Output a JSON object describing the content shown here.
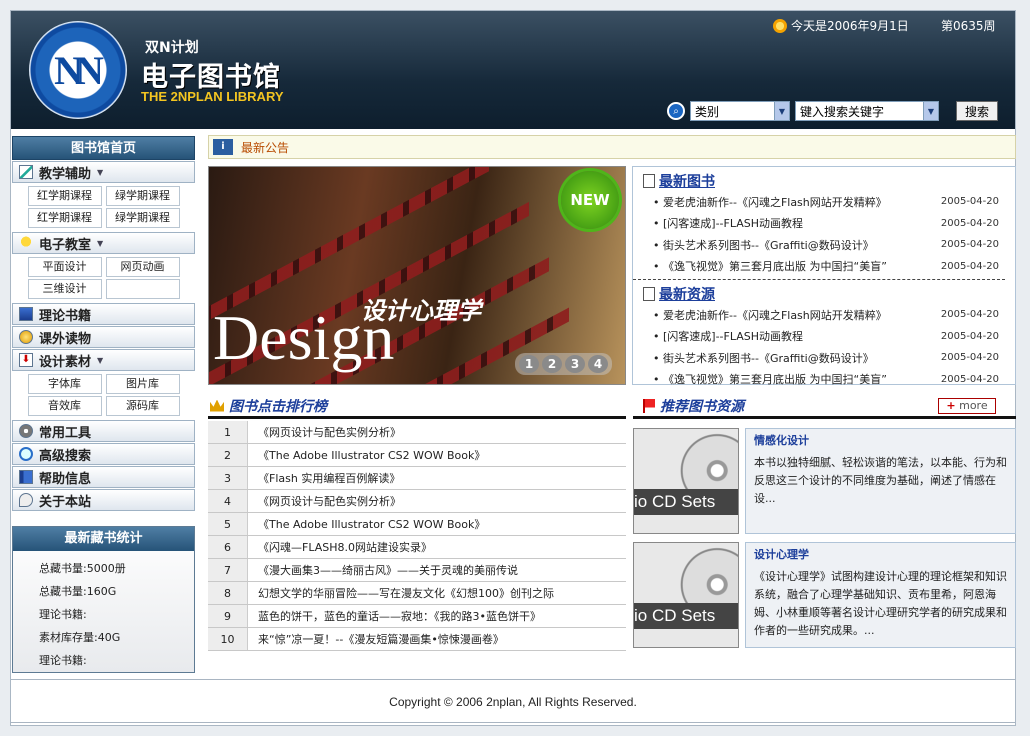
{
  "header": {
    "brand_sub": "双N计划",
    "brand_title": "电子图书馆",
    "brand_en": "THE 2NPLAN LIBRARY",
    "logo_mono": "NN",
    "date_text": "今天是2006年9月1日",
    "issue": "第0635周"
  },
  "search": {
    "category_value": "类别",
    "keyword_value": "键入搜索关键字",
    "button_label": "搜索"
  },
  "sidebar": {
    "title": "图书馆首页",
    "groups": [
      {
        "label": "教学辅助",
        "subs": [
          "红学期课程",
          "绿学期课程",
          "红学期课程",
          "绿学期课程"
        ]
      },
      {
        "label": "电子教室",
        "subs": [
          "平面设计",
          "网页动画",
          "三维设计",
          ""
        ]
      },
      {
        "label": "理论书籍"
      },
      {
        "label": "课外读物"
      },
      {
        "label": "设计素材",
        "subs": [
          "字体库",
          "图片库",
          "音效库",
          "源码库"
        ]
      },
      {
        "label": "常用工具"
      },
      {
        "label": "高级搜索"
      },
      {
        "label": "帮助信息"
      },
      {
        "label": "关于本站"
      }
    ]
  },
  "stats": {
    "title": "最新藏书统计",
    "items": [
      "总藏书量:5000册",
      "总藏书量:160G",
      "理论书籍:",
      "素材库存量:40G",
      "理论书籍:"
    ]
  },
  "notice": {
    "label": "最新公告"
  },
  "banner": {
    "cn": "设计心理学",
    "en": "Design",
    "badge": "NEW",
    "pages": [
      "1",
      "2",
      "3",
      "4"
    ]
  },
  "latest_books": {
    "title": "最新图书",
    "items": [
      {
        "t": "爱老虎油新作--《闪魂之Flash网站开发精粹》",
        "d": "2005-04-20"
      },
      {
        "t": "[闪客速成]--FLASH动画教程",
        "d": "2005-04-20"
      },
      {
        "t": "街头艺术系列图书--《Graffiti@数码设计》",
        "d": "2005-04-20"
      },
      {
        "t": "《逸飞视觉》第三套月底出版 为中国扫“美盲”",
        "d": "2005-04-20"
      }
    ]
  },
  "latest_resources": {
    "title": "最新资源",
    "items": [
      {
        "t": "爱老虎油新作--《闪魂之Flash网站开发精粹》",
        "d": "2005-04-20"
      },
      {
        "t": "[闪客速成]--FLASH动画教程",
        "d": "2005-04-20"
      },
      {
        "t": "街头艺术系列图书--《Graffiti@数码设计》",
        "d": "2005-04-20"
      },
      {
        "t": "《逸飞视觉》第三套月底出版 为中国扫“美盲”",
        "d": "2005-04-20"
      }
    ]
  },
  "ranking": {
    "title": "图书点击排行榜",
    "rows": [
      {
        "n": "1",
        "t": "《网页设计与配色实例分析》"
      },
      {
        "n": "2",
        "t": "《The Adobe Illustrator CS2 WOW Book》"
      },
      {
        "n": "3",
        "t": "《Flash 实用编程百例解读》"
      },
      {
        "n": "4",
        "t": "《网页设计与配色实例分析》"
      },
      {
        "n": "5",
        "t": "《The Adobe Illustrator CS2 WOW Book》"
      },
      {
        "n": "6",
        "t": "《闪魂—FLASH8.0网站建设实录》"
      },
      {
        "n": "7",
        "t": "《漫大画集3——绮丽古风》——关于灵魂的美丽传说"
      },
      {
        "n": "8",
        "t": "幻想文学的华丽冒险——写在漫友文化《幻想100》创刊之际"
      },
      {
        "n": "9",
        "t": "蓝色的饼干，蓝色的童话——寂地：《我的路3•蓝色饼干》"
      },
      {
        "n": "10",
        "t": "来“惊”凉一夏！--《漫友短篇漫画集•惊悚漫画卷》"
      }
    ]
  },
  "recommend": {
    "title": "推荐图书资源",
    "more_label": "more",
    "items": [
      {
        "img_text": "io CD Sets",
        "title": "情感化设计",
        "desc": "本书以独特细腻、轻松诙谐的笔法，以本能、行为和反思这三个设计的不同维度为基础，阐述了情感在设..."
      },
      {
        "img_text": "io CD Sets",
        "title": "设计心理学",
        "desc": "《设计心理学》试图构建设计心理的理论框架和知识系统，融合了心理学基础知识、贡布里希，阿恩海姆、小林重顺等著名设计心理研究学者的研究成果和作者的一些研究成果。..."
      }
    ]
  },
  "footer": {
    "copyright": "Copyright © 2006  2nplan, All Rights Reserved."
  },
  "colors": {
    "accent": "#1d3f9b",
    "header_bg": "#16293a",
    "brand_gold": "#f3c521"
  }
}
